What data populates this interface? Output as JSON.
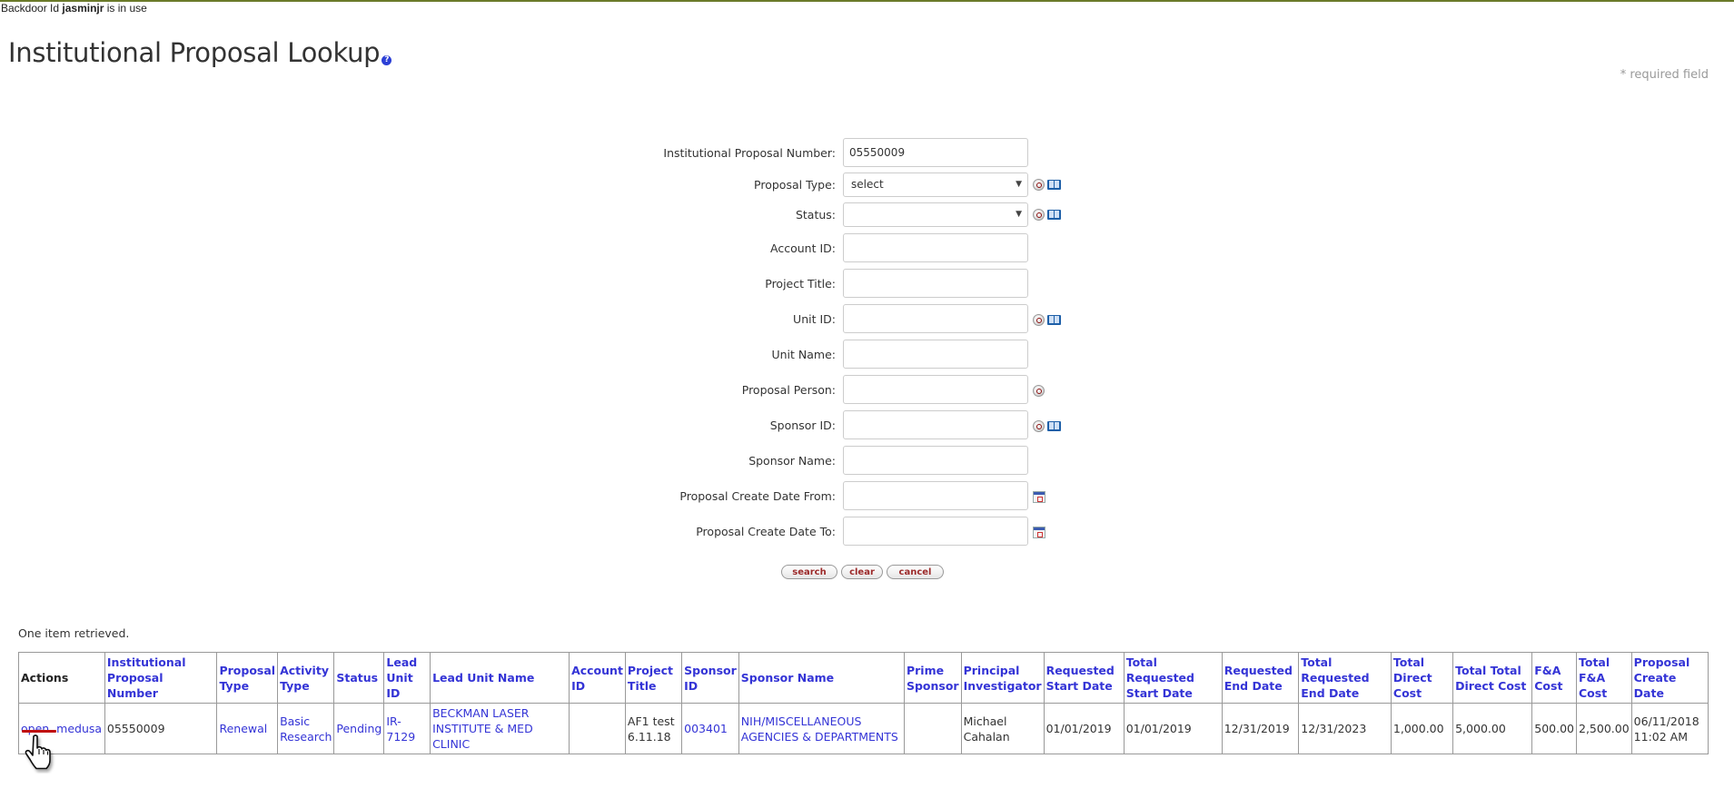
{
  "backdoor": {
    "prefix": "Backdoor Id",
    "user": "jasminjr",
    "suffix": "is in use"
  },
  "page": {
    "title": "Institutional Proposal Lookup",
    "help_icon": "?",
    "required_note": "* required field"
  },
  "form": {
    "fields": [
      {
        "label": "Institutional Proposal Number:",
        "value": "05550009",
        "type": "text",
        "icons": []
      },
      {
        "label": "Proposal Type:",
        "value": "select",
        "type": "select",
        "icons": [
          "lookup-icon",
          "book-icon"
        ]
      },
      {
        "label": "Status:",
        "value": "",
        "type": "select",
        "icons": [
          "lookup-icon",
          "book-icon"
        ]
      },
      {
        "label": "Account ID:",
        "value": "",
        "type": "text",
        "icons": []
      },
      {
        "label": "Project Title:",
        "value": "",
        "type": "text",
        "icons": []
      },
      {
        "label": "Unit ID:",
        "value": "",
        "type": "text",
        "icons": [
          "lookup-icon",
          "book-icon"
        ]
      },
      {
        "label": "Unit Name:",
        "value": "",
        "type": "text",
        "icons": []
      },
      {
        "label": "Proposal Person:",
        "value": "",
        "type": "text",
        "icons": [
          "lookup-icon"
        ]
      },
      {
        "label": "Sponsor ID:",
        "value": "",
        "type": "text",
        "icons": [
          "lookup-icon",
          "book-icon"
        ]
      },
      {
        "label": "Sponsor Name:",
        "value": "",
        "type": "text",
        "icons": []
      },
      {
        "label": "Proposal Create Date From:",
        "value": "",
        "type": "text",
        "icons": [
          "calendar-icon"
        ]
      },
      {
        "label": "Proposal Create Date To:",
        "value": "",
        "type": "text",
        "icons": [
          "calendar-icon"
        ]
      }
    ],
    "buttons": {
      "search": "search",
      "clear": "clear",
      "cancel": "cancel"
    }
  },
  "results": {
    "summary": "One item retrieved.",
    "columns": [
      "Actions",
      "Institutional Proposal Number",
      "Proposal Type",
      "Activity Type",
      "Status",
      "Lead Unit ID",
      "Lead Unit Name",
      "Account ID",
      "Project Title",
      "Sponsor ID",
      "Sponsor Name",
      "Prime Sponsor",
      "Principal Investigator",
      "Requested Start Date",
      "Total Requested Start Date",
      "Requested End Date",
      "Total Requested End Date",
      "Total Direct Cost",
      "Total Total Direct Cost",
      "F&A Cost",
      "Total F&A Cost",
      "Proposal Create Date"
    ],
    "rows": [
      {
        "actions": [
          "open",
          "medusa"
        ],
        "institutional_proposal_number": "05550009",
        "proposal_type": "Renewal",
        "activity_type": "Basic Research",
        "status": "Pending",
        "lead_unit_id": "IR-7129",
        "lead_unit_name": "BECKMAN LASER INSTITUTE & MED CLINIC",
        "account_id": "",
        "project_title": "AF1 test 6.11.18",
        "sponsor_id": "003401",
        "sponsor_name": "NIH/MISCELLANEOUS AGENCIES & DEPARTMENTS",
        "prime_sponsor": "",
        "principal_investigator": "Michael Cahalan",
        "requested_start_date": "01/01/2019",
        "total_requested_start_date": "01/01/2019",
        "requested_end_date": "12/31/2019",
        "total_requested_end_date": "12/31/2023",
        "total_direct_cost": "1,000.00",
        "total_total_direct_cost": "5,000.00",
        "fa_cost": "500.00",
        "total_fa_cost": "2,500.00",
        "proposal_create_date": "06/11/2018 11:02 AM"
      }
    ]
  }
}
